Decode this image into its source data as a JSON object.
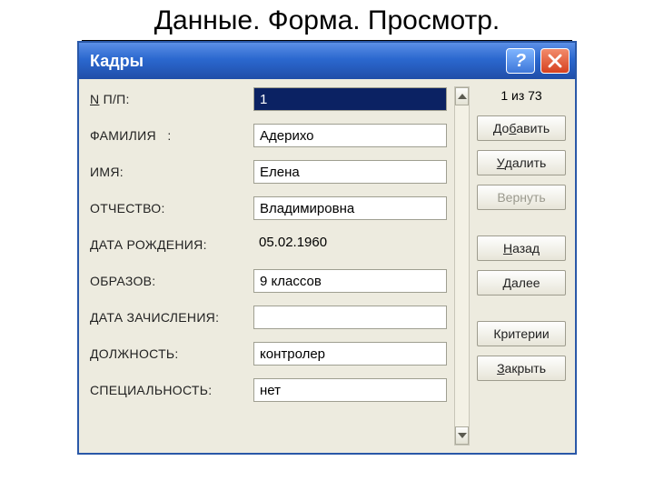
{
  "page_title": "Данные. Форма. Просмотр.",
  "window": {
    "title": "Кадры",
    "help_icon": "?"
  },
  "form": {
    "fields": [
      {
        "label": "N П/П:",
        "hotkey": "N",
        "value": "1",
        "selected": true,
        "readonly": false
      },
      {
        "label": "ФАМИЛИЯ   :",
        "value": "Адерихо",
        "selected": false,
        "readonly": false
      },
      {
        "label": "ИМЯ:",
        "value": "Елена",
        "selected": false,
        "readonly": false
      },
      {
        "label": "ОТЧЕСТВО:",
        "value": "Владимировна",
        "selected": false,
        "readonly": false
      },
      {
        "label": "ДАТА РОЖДЕНИЯ:",
        "value": "05.02.1960",
        "selected": false,
        "readonly": true
      },
      {
        "label": "ОБРАЗОВ:",
        "value": "9 классов",
        "selected": false,
        "readonly": false
      },
      {
        "label": "ДАТА ЗАЧИСЛЕНИЯ:",
        "value": "",
        "selected": false,
        "readonly": false
      },
      {
        "label": "ДОЛЖНОСТЬ:",
        "value": "контролер",
        "selected": false,
        "readonly": false
      },
      {
        "label": "СПЕЦИАЛЬНОСТЬ:",
        "value": "нет",
        "selected": false,
        "readonly": false
      }
    ]
  },
  "counter": "1 из 73",
  "buttons": {
    "add": {
      "text": "Добавить",
      "hk": "б"
    },
    "delete": {
      "text": "Удалить",
      "hk": "У"
    },
    "restore": {
      "text": "Вернуть",
      "disabled": true
    },
    "back": {
      "text": "Назад",
      "hk": "Н"
    },
    "next": {
      "text": "Далее",
      "hk": "Д"
    },
    "criteria": {
      "text": "Критерии"
    },
    "close": {
      "text": "Закрыть",
      "hk": "З"
    }
  }
}
